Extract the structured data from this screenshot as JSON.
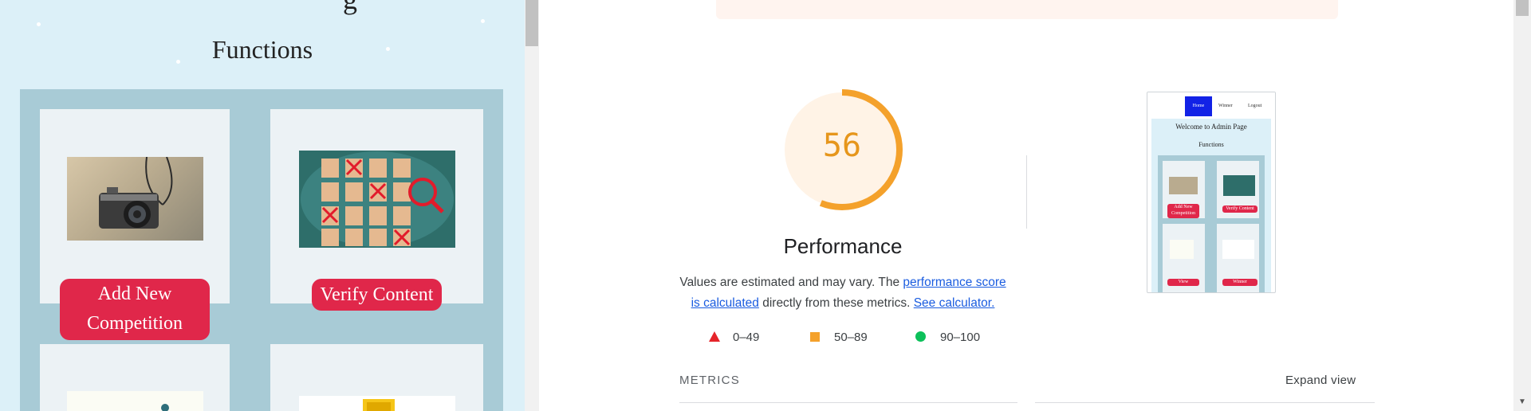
{
  "left_page": {
    "heading_fragment": "g",
    "functions_title": "Functions",
    "cards": [
      {
        "button_label": "Add New Competition",
        "image": "camera-photo"
      },
      {
        "button_label": "Verify Content",
        "image": "people-grid-photo"
      },
      {
        "image": "chart-illustration"
      },
      {
        "image": "trophy-illustration"
      }
    ]
  },
  "report": {
    "score": "56",
    "category_title": "Performance",
    "description": {
      "prefix": "Values are estimated and may vary. The ",
      "link1": "performance score is calculated",
      "middle": " directly from these metrics. ",
      "link2": "See calculator."
    },
    "legend": [
      {
        "range": "0–49",
        "shape": "triangle",
        "color": "#e5242a"
      },
      {
        "range": "50–89",
        "shape": "square",
        "color": "#f4a12b"
      },
      {
        "range": "90–100",
        "shape": "circle",
        "color": "#0cc05a"
      }
    ],
    "metrics_label": "METRICS",
    "expand_label": "Expand view",
    "gauge_color": "#f4a12b",
    "gauge_fraction": 0.56
  },
  "thumbnail": {
    "nav": {
      "home": "Home",
      "winner": "Winner",
      "logout": "Logout"
    },
    "welcome": "Welcome to Admin Page",
    "functions": "Functions",
    "buttons": [
      "Add New Competition",
      "Verify Content",
      "View",
      "Winner"
    ]
  },
  "colors": {
    "page_bg": "#dcf0f8",
    "grid_bg": "#a8cbd6",
    "button_red": "#e0274a",
    "link_blue": "#1a5ce0"
  }
}
